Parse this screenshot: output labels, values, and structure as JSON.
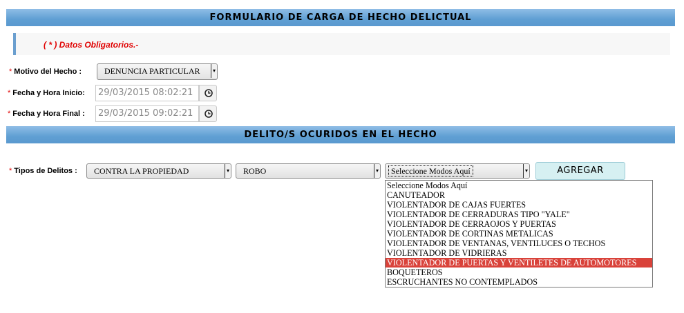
{
  "header": {
    "title": "FORMULARIO DE CARGA DE HECHO DELICTUAL"
  },
  "info": {
    "required_note": "( * ) Datos Obligatorios.-"
  },
  "form": {
    "required_mark": "*",
    "motivo": {
      "label": "Motivo del Hecho :",
      "value": "DENUNCIA PARTICULAR"
    },
    "fecha_inicio": {
      "label": "Fecha y Hora Inicio:",
      "value": "29/03/2015 08:02:21"
    },
    "fecha_final": {
      "label": "Fecha y Hora Final :",
      "value": "29/03/2015 09:02:21"
    }
  },
  "section2": {
    "title": "DELITO/S OCURIDOS EN EL HECHO"
  },
  "delitos": {
    "label": "Tipos de Delitos :",
    "tipo_value": "CONTRA LA PROPIEDAD",
    "subtipo_value": "ROBO",
    "modo_value": "Seleccione Modos Aquí",
    "add_button": "AGREGAR",
    "modo_options": [
      "Seleccione Modos Aquí",
      "CANUTEADOR",
      "VIOLENTADOR DE CAJAS FUERTES",
      "VIOLENTADOR DE CERRADURAS TIPO \"YALE\"",
      "VIOLENTADOR DE CERRAOJOS Y PUERTAS",
      "VIOLENTADOR DE CORTINAS METALICAS",
      "VIOLENTADOR DE VENTANAS, VENTILUCES O TECHOS",
      "VIOLENTADOR DE VIDRIERAS",
      "VIOLENTADOR DE PUERTAS Y VENTILETES DE AUTOMOTORES",
      "BOQUETEROS",
      "ESCRUCHANTES NO CONTEMPLADOS"
    ],
    "highlighted_option": "VIOLENTADOR DE PUERTAS Y VENTILETES DE AUTOMOTORES"
  },
  "colors": {
    "header_bg": "#5f9fd3",
    "required": "#e00000",
    "highlight": "#d9423a",
    "button_bg": "#d6f0f2"
  },
  "icons": {
    "clock": "clock-icon",
    "arrow": "chevron-down-icon"
  }
}
